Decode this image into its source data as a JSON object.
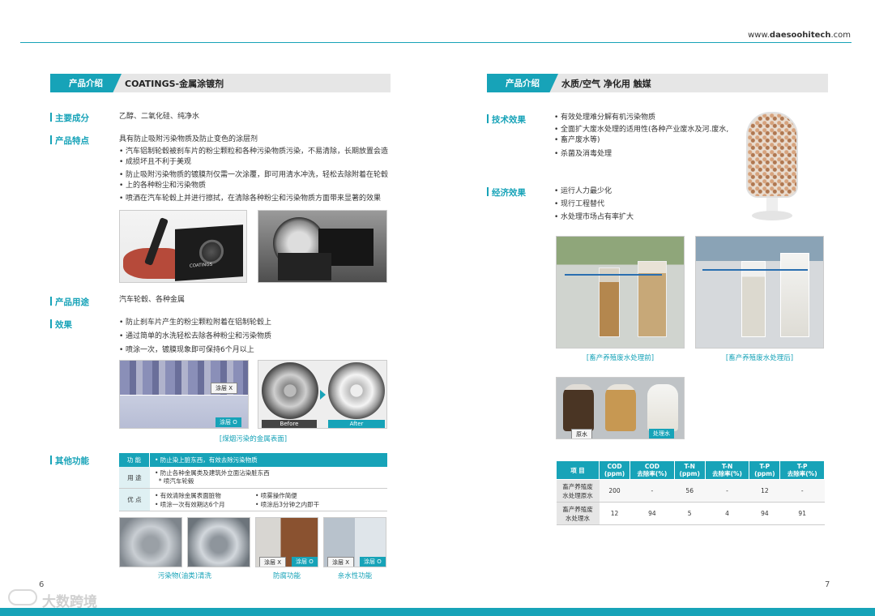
{
  "site": {
    "prefix": "www.",
    "bold": "daesoohitech",
    "suffix": ".com"
  },
  "left": {
    "header": {
      "tag": "产品介绍",
      "title": "COATINGS-金属涂镀剂"
    },
    "main_ingredient": {
      "label": "主要成分",
      "text": "乙醇、二氧化硅、纯净水"
    },
    "features": {
      "label": "产品特点",
      "intro": "具有防止吸附污染物质及防止变色的涂层剂",
      "bullets": [
        "汽车铝制轮毂被刹车片的粉尘颗粒和各种污染物质污染，不易清除，长期放置会造",
        "成损坏且不利于美观",
        "防止吸附污染物质的镀膜剂仅需一次涂覆，即可用清水冲洗，轻松去除附着在轮毂",
        "上的各种粉尘和污染物质",
        "喷洒在汽车轮毂上并进行擦拭，在清除各种粉尘和污染物质方面带来显著的效果"
      ],
      "product_text": "COATINGS"
    },
    "usage": {
      "label": "产品用途",
      "text": "汽车轮毂、各种金属"
    },
    "effect": {
      "label": "效果",
      "bullets": [
        "防止刹车片产生的粉尘颗粒附着在铝制轮毂上",
        "通过简单的水洗轻松去除各种粉尘和污染物质",
        "喷涂一次，镀膜现象即可保持6个月以上"
      ],
      "coat_x": "涂层 X",
      "coat_o": "涂层 O",
      "before": "Before",
      "after": "After",
      "caption": "[煤烟污染的金属表面]"
    },
    "other": {
      "label": "其他功能",
      "rows": [
        {
          "head": "功 能",
          "lines": [
            "• 防止染上脏东西，有效去除污染物质"
          ]
        },
        {
          "head": "用 途",
          "lines": [
            "• 防止各种金属类及建筑外立面沾染脏东西",
            "  * 喷汽车轮毂"
          ]
        },
        {
          "head": "优 点",
          "lines": [
            "• 有效清除金属表面脏物",
            "• 喷涂一次有效期达6个月"
          ],
          "lines2": [
            "• 喷雾操作简便",
            "• 喷涂后3分钟之内即干"
          ]
        }
      ],
      "coat_x": "涂层 X",
      "coat_o": "涂层 O",
      "captions": [
        "污染物(油类)清洗",
        "防腐功能",
        "亲水性功能"
      ]
    },
    "page": "6"
  },
  "right": {
    "header": {
      "tag": "产品介绍",
      "title": "水质/空气 净化用 触媒"
    },
    "tech": {
      "label": "技术效果",
      "bullets": [
        "有效处理难分解有机污染物质",
        "全面扩大废水处理的适用性(各种产业废水及河.废水,",
        "畜产废水等)",
        "杀菌及消毒处理"
      ]
    },
    "econ": {
      "label": "经济效果",
      "bullets": [
        "运行人力最少化",
        "现行工程替代",
        "水处理市场占有率扩大"
      ]
    },
    "captions": [
      "[畜产养殖废水处理前]",
      "[畜产养殖废水处理后]"
    ],
    "bottle_labels": {
      "raw": "原水",
      "treated": "处理水"
    },
    "table": {
      "headers": [
        "项 目",
        "COD\n(ppm)",
        "COD\n去除率(%)",
        "T-N\n(ppm)",
        "T-N\n去除率(%)",
        "T-P\n(ppm)",
        "T-P\n去除率(%)"
      ],
      "rows": [
        [
          "畜产养殖废\n水处理原水",
          "200",
          "-",
          "56",
          "-",
          "12",
          "-"
        ],
        [
          "畜产养殖废\n水处理水",
          "12",
          "94",
          "5",
          "4",
          "94",
          "91"
        ]
      ]
    },
    "page": "7"
  },
  "watermark": "大数跨境",
  "colors": {
    "accent": "#17a3b8",
    "header_bg": "#e6e6e6"
  }
}
